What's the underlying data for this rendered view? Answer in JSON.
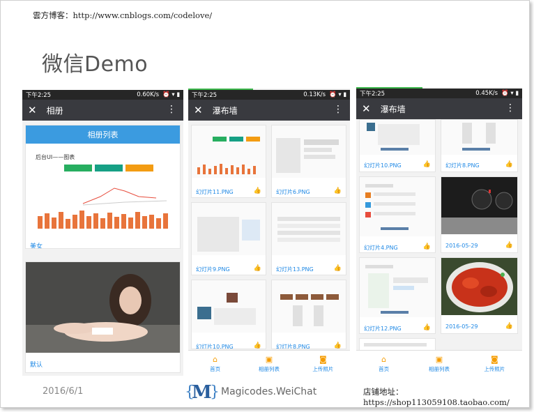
{
  "slide": {
    "top_note": "雲方博客：http://www.cnblogs.com/codelove/",
    "title": "微信Demo",
    "date": "2016/6/1",
    "brand": "Magicodes.WeiChat",
    "shop": "店铺地址：https://shop113059108.taobao.com/"
  },
  "phone1": {
    "time": "下午2:25",
    "speed": "0.60K/s",
    "title": "相册",
    "album_header": "相册列表",
    "chart_title": "后台UI——图表",
    "card1_label": "美女",
    "card2_label": "默认"
  },
  "phone2": {
    "time": "下午2:25",
    "speed": "0.13K/s",
    "title": "瀑布墙",
    "items": [
      {
        "label": "幻灯片11.PNG"
      },
      {
        "label": "幻灯片6.PNG"
      },
      {
        "label": "幻灯片9.PNG"
      },
      {
        "label": "幻灯片13.PNG"
      },
      {
        "label": "幻灯片10.PNG"
      },
      {
        "label": "幻灯片8.PNG"
      }
    ],
    "tabs": [
      {
        "label": "首页",
        "icon": "home-icon"
      },
      {
        "label": "相册列表",
        "icon": "album-icon"
      },
      {
        "label": "上传照片",
        "icon": "camera-icon"
      }
    ]
  },
  "phone3": {
    "time": "下午2:25",
    "speed": "0.45K/s",
    "title": "瀑布墙",
    "left_items": [
      {
        "label": "幻灯片10.PNG"
      },
      {
        "label": "幻灯片4.PNG"
      },
      {
        "label": "幻灯片12.PNG"
      }
    ],
    "right_items": [
      {
        "label": "幻灯片8.PNG"
      },
      {
        "label": "2016-05-29"
      },
      {
        "label": "2016-05-29"
      }
    ],
    "tabs": [
      {
        "label": "首页",
        "icon": "home-icon"
      },
      {
        "label": "相册列表",
        "icon": "album-icon"
      },
      {
        "label": "上传照片",
        "icon": "camera-icon"
      }
    ]
  }
}
